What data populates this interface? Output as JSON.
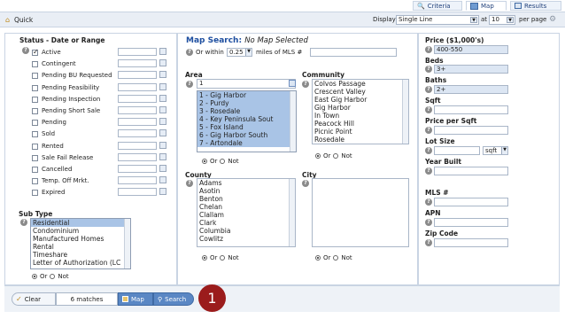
{
  "top_tabs": [
    {
      "label": "Criteria",
      "icon": "magnifier-icon"
    },
    {
      "label": "Map",
      "icon": "map-icon"
    },
    {
      "label": "Results",
      "icon": "grid-icon"
    }
  ],
  "quick": {
    "label": "Quick"
  },
  "display": {
    "label": "Display",
    "value": "Single Line",
    "at_label": "at",
    "per_page_value": "10",
    "per_page_label": "per page"
  },
  "status": {
    "title": "Status - Date or Range",
    "items": [
      {
        "label": "Active",
        "checked": true
      },
      {
        "label": "Contingent",
        "checked": false
      },
      {
        "label": "Pending BU Requested",
        "checked": false
      },
      {
        "label": "Pending Feasibility",
        "checked": false
      },
      {
        "label": "Pending Inspection",
        "checked": false
      },
      {
        "label": "Pending Short Sale",
        "checked": false
      },
      {
        "label": "Pending",
        "checked": false
      },
      {
        "label": "Sold",
        "checked": false
      },
      {
        "label": "Rented",
        "checked": false
      },
      {
        "label": "Sale Fail Release",
        "checked": false
      },
      {
        "label": "Cancelled",
        "checked": false
      },
      {
        "label": "Temp. Off Mrkt.",
        "checked": false
      },
      {
        "label": "Expired",
        "checked": false
      }
    ]
  },
  "subtype": {
    "title": "Sub Type",
    "items": [
      "Residential",
      "Condominium",
      "Manufactured Homes",
      "Rental",
      "Timeshare",
      "Letter of Authorization (LC"
    ],
    "selected": 0
  },
  "or_not": {
    "or": "Or",
    "not": "Not"
  },
  "map_search": {
    "title": "Map Search:",
    "status": "No Map Selected",
    "or_within": "Or within",
    "miles_value": "0.25",
    "miles_label": "miles of MLS #"
  },
  "area": {
    "title": "Area",
    "input_value": "1",
    "items": [
      "1 - Gig Harbor",
      "2 - Purdy",
      "3 - Rosedale",
      "4 - Key Peninsula Sout",
      "5 - Fox Island",
      "6 - Gig Harbor South",
      "7 - Artondale"
    ]
  },
  "community": {
    "title": "Community",
    "items": [
      "Colvos Passage",
      "Crescent Valley",
      "East Gig Harbor",
      "Gig Harbor",
      "In Town",
      "Peacock Hill",
      "Picnic Point",
      "Rosedale"
    ]
  },
  "county": {
    "title": "County",
    "items": [
      "Adams",
      "Asotin",
      "Benton",
      "Chelan",
      "Clallam",
      "Clark",
      "Columbia",
      "Cowlitz"
    ]
  },
  "city": {
    "title": "City"
  },
  "right": {
    "price": {
      "label": "Price ($1,000's)",
      "value": "400-550"
    },
    "beds": {
      "label": "Beds",
      "value": "3+"
    },
    "baths": {
      "label": "Baths",
      "value": "2+"
    },
    "sqft": {
      "label": "Sqft"
    },
    "price_per_sqft": {
      "label": "Price per Sqft"
    },
    "lot_size": {
      "label": "Lot Size",
      "unit": "sqft"
    },
    "year_built": {
      "label": "Year Built"
    },
    "mls": {
      "label": "MLS #"
    },
    "apn": {
      "label": "APN"
    },
    "zip": {
      "label": "Zip Code"
    }
  },
  "bottom": {
    "clear": "Clear",
    "matches": "6 matches",
    "map": "Map",
    "search": "Search"
  },
  "callout": {
    "number": "1",
    "color": "#9b1c1c"
  }
}
